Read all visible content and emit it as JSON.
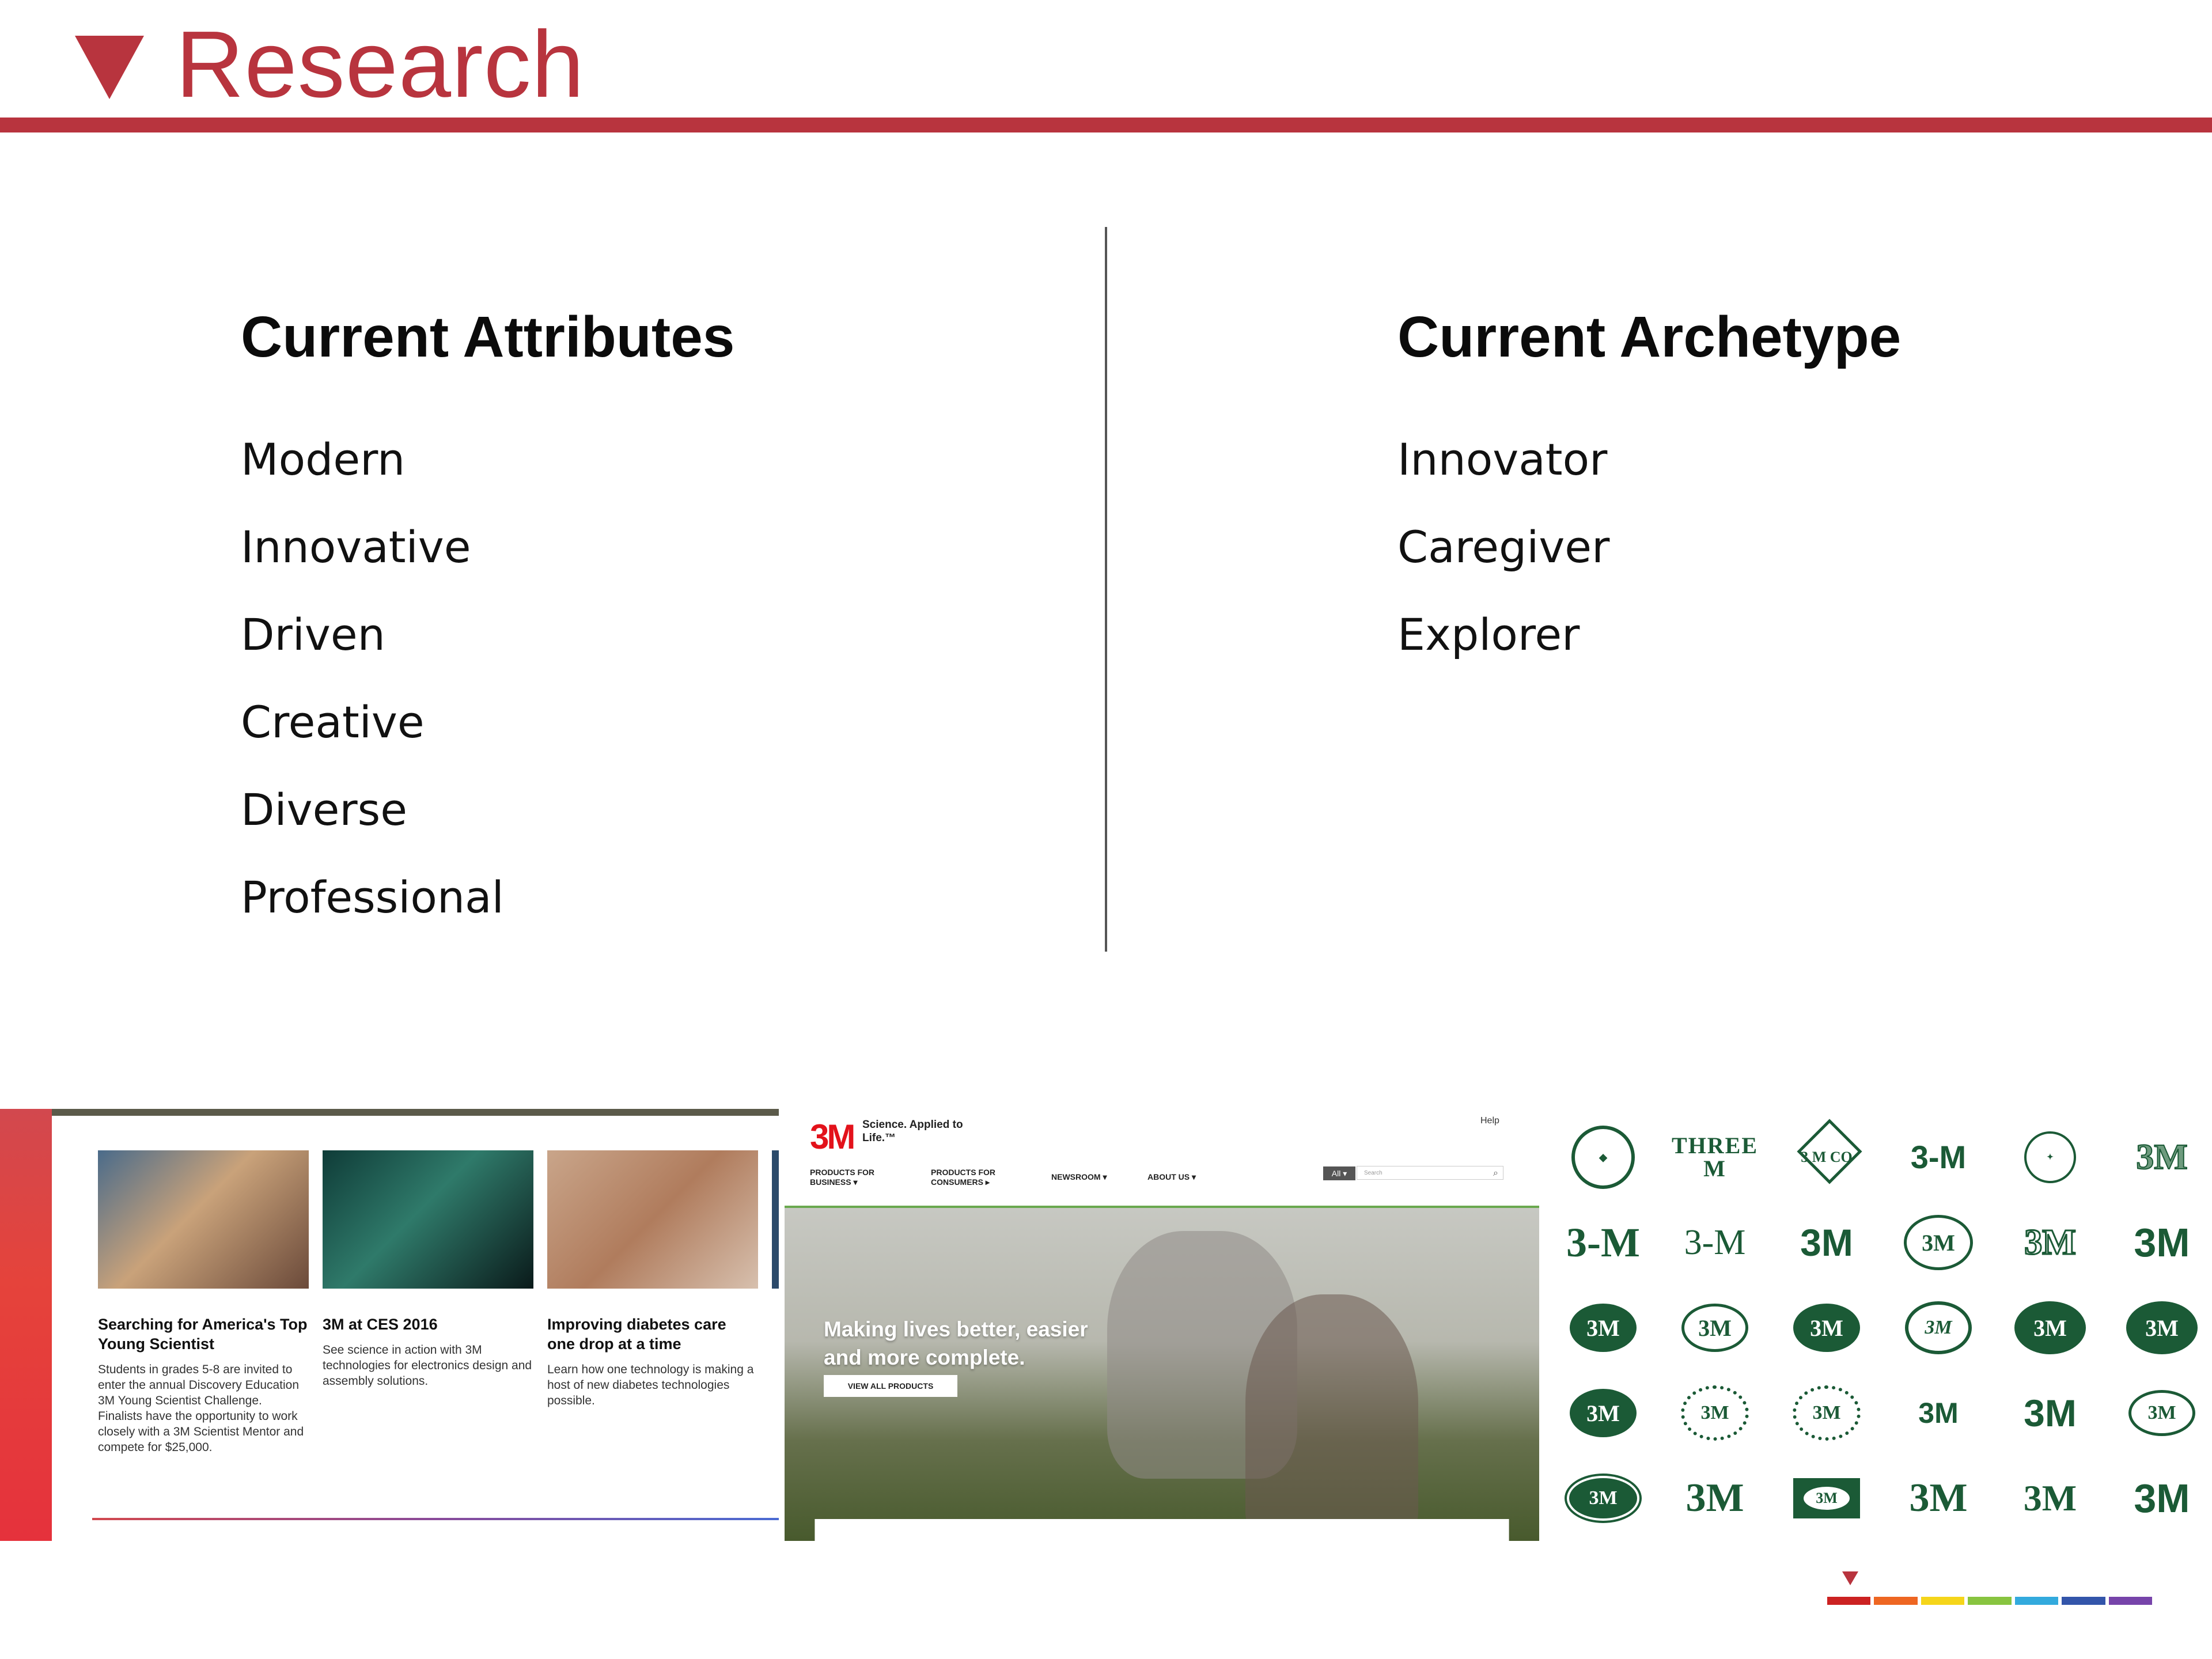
{
  "header": {
    "title": "Research",
    "accent_color": "#b8343e"
  },
  "attributes": {
    "title": "Current Attributes",
    "items": [
      "Modern",
      "Innovative",
      "Driven",
      "Creative",
      "Diverse",
      "Professional"
    ]
  },
  "archetype": {
    "title": "Current Archetype",
    "items": [
      "Innovator",
      "Caregiver",
      "Explorer"
    ]
  },
  "website_cards": {
    "cards": [
      {
        "title": "Searching for America's Top Young Scientist",
        "body": "Students in grades 5-8 are invited to enter the annual Discovery Education 3M Young Scientist Challenge. Finalists have the opportunity to work closely with a 3M Scientist Mentor and compete for $25,000."
      },
      {
        "title": "3M at CES 2016",
        "body": "See science in action with 3M technologies for electronics design and assembly solutions."
      },
      {
        "title": "Improving diabetes care one drop at a time",
        "body": "Learn how one technology is making a host of new diabetes technologies possible."
      }
    ]
  },
  "homepage": {
    "logo": "3M",
    "tagline": "Science. Applied to Life.™",
    "help": "Help",
    "nav": [
      "PRODUCTS FOR BUSINESS",
      "PRODUCTS FOR CONSUMERS",
      "NEWSROOM",
      "ABOUT US"
    ],
    "search_select": "All",
    "search_placeholder": "Search",
    "hero_text": "Making lives better, easier and more complete.",
    "hero_button": "VIEW ALL PRODUCTS"
  },
  "logo_grid": {
    "rows": [
      [
        "",
        "THREE M",
        "3 M CO",
        "3-M",
        "",
        "3M"
      ],
      [
        "3-M",
        "3-M",
        "3M",
        "3M",
        "3M",
        "3M"
      ],
      [
        "3M",
        "3M",
        "3M",
        "3M",
        "3M",
        "3M"
      ],
      [
        "3M",
        "3M",
        "3M",
        "3M",
        "3M",
        "3M"
      ],
      [
        "3M",
        "3M",
        "3M",
        "3M",
        "3M",
        "3M"
      ]
    ],
    "color": "#1b5a36"
  },
  "footer": {
    "colors": [
      "#cc2222",
      "#ee6622",
      "#f5d51a",
      "#88c440",
      "#33aadd",
      "#3355aa",
      "#7744aa"
    ]
  }
}
